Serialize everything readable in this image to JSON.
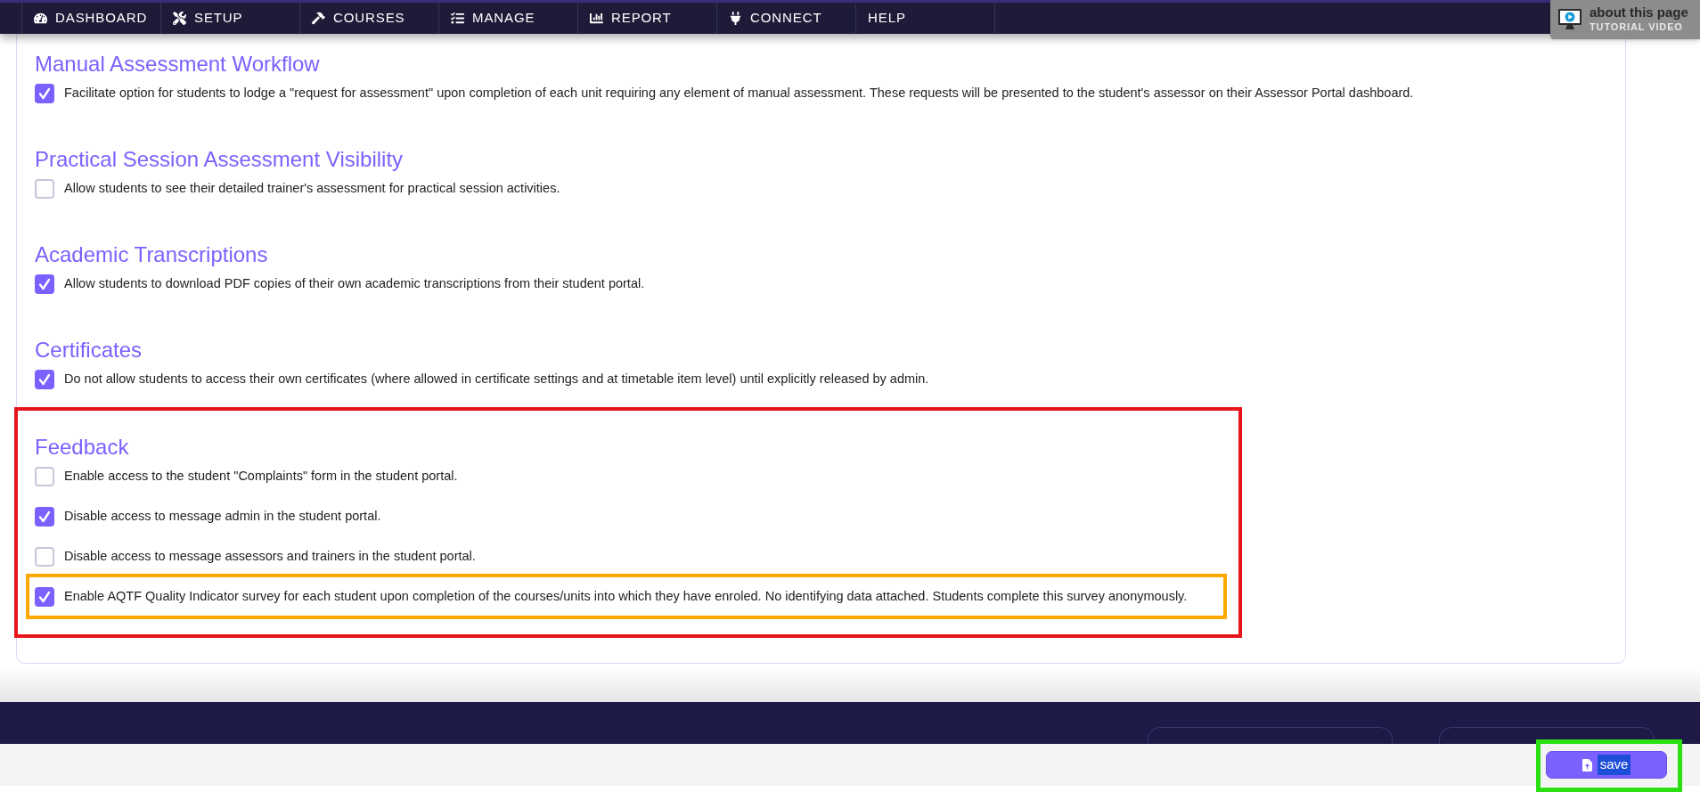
{
  "nav": {
    "items": [
      {
        "label": "DASHBOARD"
      },
      {
        "label": "SETUP"
      },
      {
        "label": "COURSES"
      },
      {
        "label": "MANAGE"
      },
      {
        "label": "REPORT"
      },
      {
        "label": "CONNECT"
      },
      {
        "label": "HELP"
      }
    ]
  },
  "tutorial_badge": {
    "title": "about this page",
    "subtitle": "TUTORIAL VIDEO"
  },
  "sections": [
    {
      "heading": "Manual Assessment Workflow",
      "options": [
        {
          "label": "Facilitate option for students to lodge a \"request for assessment\" upon completion of each unit requiring any element of manual assessment. These requests will be presented to the student's assessor on their Assessor Portal dashboard.",
          "checked": true
        }
      ]
    },
    {
      "heading": "Practical Session Assessment Visibility",
      "options": [
        {
          "label": "Allow students to see their detailed trainer's assessment for practical session activities.",
          "checked": false
        }
      ]
    },
    {
      "heading": "Academic Transcriptions",
      "options": [
        {
          "label": "Allow students to download PDF copies of their own academic transcriptions from their student portal.",
          "checked": true
        }
      ]
    },
    {
      "heading": "Certificates",
      "options": [
        {
          "label": "Do not allow students to access their own certificates (where allowed in certificate settings and at timetable item level) until explicitly released by admin.",
          "checked": true
        }
      ]
    },
    {
      "heading": "Feedback",
      "options": [
        {
          "label": "Enable access to the student \"Complaints\" form in the student portal.",
          "checked": false
        },
        {
          "label": "Disable access to message admin in the student portal.",
          "checked": true
        },
        {
          "label": "Disable access to message assessors and trainers in the student portal.",
          "checked": false
        },
        {
          "label": "Enable AQTF Quality Indicator survey for each student upon completion of the courses/units into which they have enroled. No identifying data attached. Students complete this survey anonymously.",
          "checked": true
        }
      ]
    }
  ],
  "save_button": {
    "label": "save"
  }
}
